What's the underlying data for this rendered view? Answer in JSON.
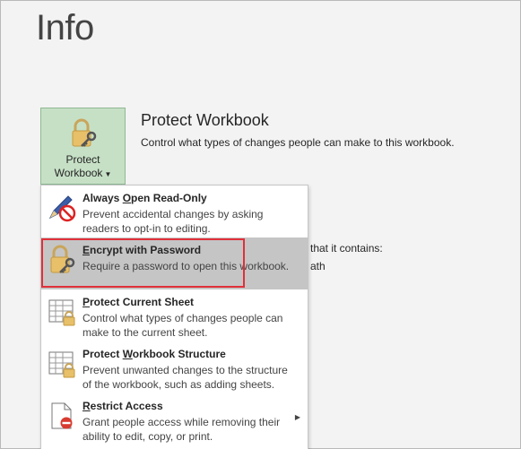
{
  "page": {
    "title": "Info"
  },
  "protect_button": {
    "line1": "Protect",
    "line2": "Workbook"
  },
  "section": {
    "title": "Protect Workbook",
    "description": "Control what types of changes people can make to this workbook."
  },
  "background_text": {
    "line1": "that it contains:",
    "line2": "ath"
  },
  "menu": {
    "items": [
      {
        "title_pre": "Always ",
        "title_u": "O",
        "title_post": "pen Read-Only",
        "desc1": "Prevent accidental changes by asking",
        "desc2": "readers to opt-in to editing."
      },
      {
        "title_pre": "",
        "title_u": "E",
        "title_post": "ncrypt with Password",
        "desc1": "Require a password to open this workbook.",
        "desc2": ""
      },
      {
        "title_pre": "",
        "title_u": "P",
        "title_post": "rotect Current Sheet",
        "desc1": "Control what types of changes people can",
        "desc2": "make to the current sheet."
      },
      {
        "title_pre": "Protect ",
        "title_u": "W",
        "title_post": "orkbook Structure",
        "desc1": "Prevent unwanted changes to the structure",
        "desc2": "of the workbook, such as adding sheets."
      },
      {
        "title_pre": "",
        "title_u": "R",
        "title_post": "estrict Access",
        "desc1": "Grant people access while removing their",
        "desc2": "ability to edit, copy, or print."
      }
    ]
  },
  "colors": {
    "button_bg": "#c6e0c6",
    "highlight_row": "#c5c5c5",
    "annotation_border": "#e0303a"
  }
}
